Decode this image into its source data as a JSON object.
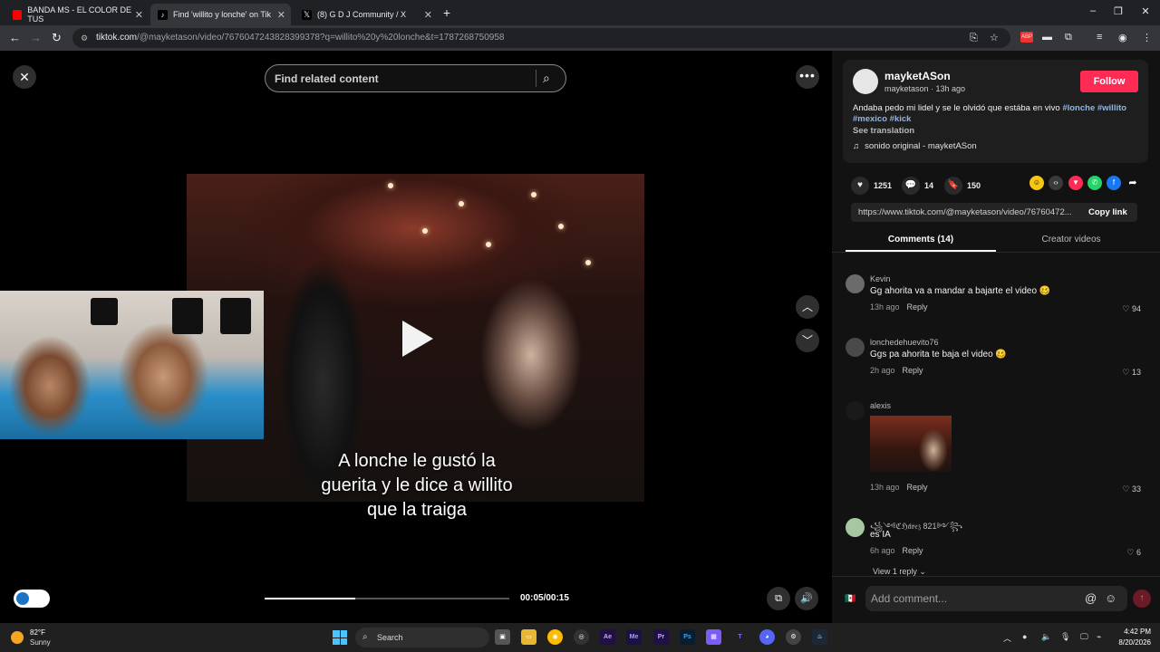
{
  "browser": {
    "tabs": [
      {
        "title": "BANDA MS - EL COLOR DE TUS",
        "favicon_color": "#ff0000"
      },
      {
        "title": "Find 'willito y lonche' on Tik",
        "favicon_color": "#000000"
      },
      {
        "title": "(8) G D J Community / X",
        "favicon_color": "#000000"
      }
    ],
    "url_host": "tiktok.com",
    "url_path": "/@mayketason/video/7676047243828399378?q=willito%20y%20lonche&t=1787268750958"
  },
  "player": {
    "search_placeholder": "Find related content",
    "caption_lines": [
      "A lonche le gustó la",
      "guerita y le dice a willito",
      "que la traiga"
    ],
    "time": "00:05/00:15",
    "progress_fraction": 0.37
  },
  "creator": {
    "display_name": "mayketASon",
    "handle_time": "mayketason · 13h ago",
    "follow_label": "Follow",
    "description": "Andaba pedo mi lidel y se le olvidó que estába en vivo",
    "hashtags": [
      "#lonche",
      "#willito",
      "#mexico",
      "#kick"
    ],
    "see_translation": "See translation",
    "music": "sonido original - mayketASon"
  },
  "stats": {
    "likes": "1251",
    "comments": "14",
    "saves": "150"
  },
  "share": {
    "link": "https://www.tiktok.com/@mayketason/video/76760472...",
    "copy_label": "Copy link"
  },
  "tabs": {
    "comments": "Comments (14)",
    "creator_videos": "Creator videos"
  },
  "comments": [
    {
      "user": "Kevin",
      "text": "Gg ahorita va a mandar a bajarte el video 🥴",
      "time": "13h ago",
      "reply": "Reply",
      "likes": "94"
    },
    {
      "user": "lonchedehuevito76",
      "text": "Ggs pa ahorita te baja el video 🥴",
      "time": "2h ago",
      "reply": "Reply",
      "likes": "13"
    },
    {
      "user": "alexis",
      "text": "",
      "time": "13h ago",
      "reply": "Reply",
      "likes": "33"
    },
    {
      "user": "꧁༺ℭℌ𝔞́𝔳𝔢𝔷 821༻꧂",
      "text": "es IA",
      "time": "6h ago",
      "reply": "Reply",
      "likes": "6"
    }
  ],
  "view_reply": "View 1 reply",
  "comment_box": {
    "placeholder": "Add comment..."
  },
  "taskbar": {
    "temp": "82°F",
    "condition": "Sunny",
    "search_label": "Search",
    "time": "4:42 PM",
    "date": "8/20/2026"
  }
}
